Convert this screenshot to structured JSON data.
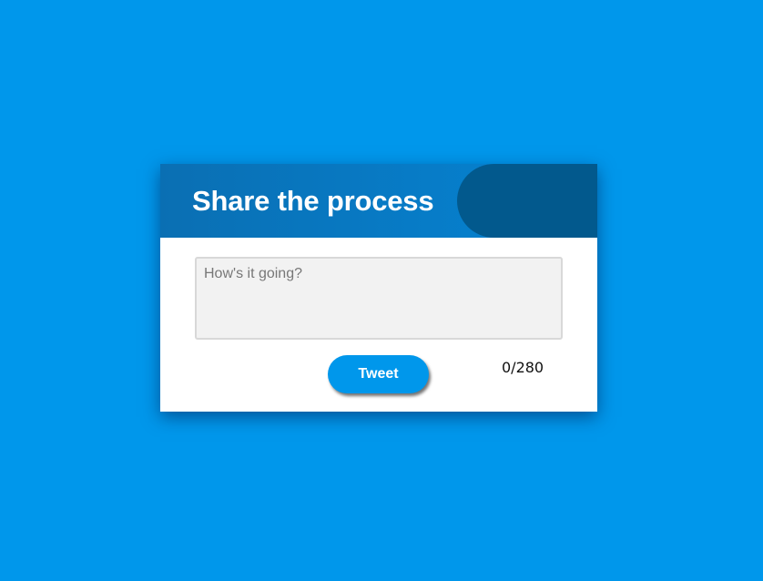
{
  "composer": {
    "title": "Share the process",
    "input": {
      "value": "",
      "placeholder": "How's it going?"
    },
    "tweet_label": "Tweet",
    "counter": "0/280"
  },
  "colors": {
    "background": "#0097eb",
    "header_start": "#0a6fb3",
    "header_end": "#0584d4",
    "header_pill": "#02598d",
    "button": "#0097eb",
    "input_background": "#f2f2f2"
  }
}
